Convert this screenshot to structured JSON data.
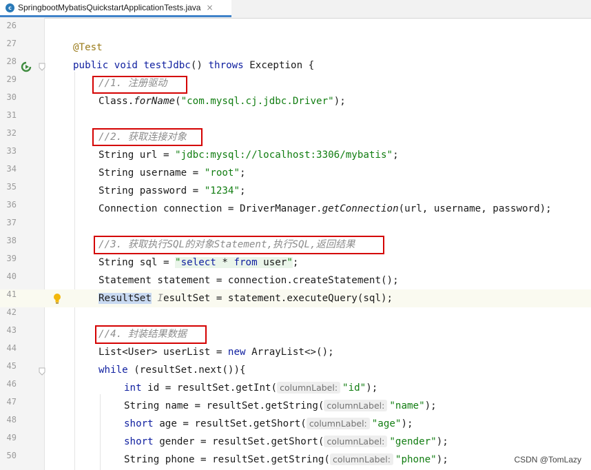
{
  "tab": {
    "title": "SpringbootMybatisQuickstartApplicationTests.java",
    "close": "×",
    "icon": "c"
  },
  "lines": [
    {
      "n": "26",
      "tokens": []
    },
    {
      "n": "27",
      "tokens": [
        {
          "t": "@Test",
          "c": "ann"
        }
      ]
    },
    {
      "n": "28",
      "tokens": [
        {
          "t": "public void ",
          "c": "kw"
        },
        {
          "t": "testJdbc",
          "c": "kw"
        },
        {
          "t": "() "
        },
        {
          "t": "throws",
          "c": "kw"
        },
        {
          "t": " Exception {"
        }
      ]
    },
    {
      "n": "29",
      "tokens": [
        {
          "t": "//1. 注册驱动",
          "c": "cmt"
        }
      ]
    },
    {
      "n": "30",
      "tokens": [
        {
          "t": "Class."
        },
        {
          "t": "forName",
          "c": "it"
        },
        {
          "t": "("
        },
        {
          "t": "\"com.mysql.cj.jdbc.Driver\"",
          "c": "str"
        },
        {
          "t": ");"
        }
      ]
    },
    {
      "n": "31",
      "tokens": []
    },
    {
      "n": "32",
      "tokens": [
        {
          "t": "//2. 获取连接对象",
          "c": "cmt"
        }
      ]
    },
    {
      "n": "33",
      "tokens": [
        {
          "t": "String url = "
        },
        {
          "t": "\"jdbc:mysql://localhost:3306/mybatis\"",
          "c": "str"
        },
        {
          "t": ";"
        }
      ]
    },
    {
      "n": "34",
      "tokens": [
        {
          "t": "String username = "
        },
        {
          "t": "\"root\"",
          "c": "str"
        },
        {
          "t": ";"
        }
      ]
    },
    {
      "n": "35",
      "tokens": [
        {
          "t": "String password = "
        },
        {
          "t": "\"1234\"",
          "c": "str"
        },
        {
          "t": ";"
        }
      ]
    },
    {
      "n": "36",
      "tokens": [
        {
          "t": "Connection connection = DriverManager."
        },
        {
          "t": "getConnection",
          "c": "it"
        },
        {
          "t": "(url, username, password);"
        }
      ]
    },
    {
      "n": "37",
      "tokens": []
    },
    {
      "n": "38",
      "tokens": [
        {
          "t": "//3. 获取执行SQL的对象Statement,执行SQL,返回结果",
          "c": "cmt"
        }
      ]
    },
    {
      "n": "39",
      "tokens": [
        {
          "t": "String sql = "
        },
        {
          "t": "\"",
          "c": "str sqlbg"
        },
        {
          "t": "select",
          "c": "kw sqlbg"
        },
        {
          "t": " * ",
          "c": "sqlbg"
        },
        {
          "t": "from",
          "c": "kw sqlbg"
        },
        {
          "t": " user",
          "c": "sqlbg"
        },
        {
          "t": "\"",
          "c": "str sqlbg"
        },
        {
          "t": ";"
        }
      ]
    },
    {
      "n": "40",
      "tokens": [
        {
          "t": "Statement statement = connection.createStatement();"
        }
      ]
    },
    {
      "n": "41",
      "tokens": [
        {
          "t": "ResultSet",
          "c": "selword"
        },
        {
          "t": " "
        },
        {
          "t": "I",
          "c": "cmt"
        },
        {
          "t": "esultSet = statement.executeQuery(sql);"
        }
      ]
    },
    {
      "n": "42",
      "tokens": []
    },
    {
      "n": "43",
      "tokens": [
        {
          "t": "//4. 封装结果数据",
          "c": "cmt"
        }
      ]
    },
    {
      "n": "44",
      "tokens": [
        {
          "t": "List<User> userList = "
        },
        {
          "t": "new",
          "c": "kw"
        },
        {
          "t": " ArrayList<>();"
        }
      ]
    },
    {
      "n": "45",
      "tokens": [
        {
          "t": "while",
          "c": "kw"
        },
        {
          "t": " (resultSet.next()){"
        }
      ]
    },
    {
      "n": "46",
      "tokens": [
        {
          "t": "int",
          "c": "kw"
        },
        {
          "t": " id = resultSet.getInt("
        },
        {
          "t": "columnLabel:",
          "c": "hint"
        },
        {
          "t": "\"id\"",
          "c": "str"
        },
        {
          "t": ");"
        }
      ]
    },
    {
      "n": "47",
      "tokens": [
        {
          "t": "String name = resultSet.getString("
        },
        {
          "t": "columnLabel:",
          "c": "hint"
        },
        {
          "t": "\"name\"",
          "c": "str"
        },
        {
          "t": ");"
        }
      ]
    },
    {
      "n": "48",
      "tokens": [
        {
          "t": "short",
          "c": "kw"
        },
        {
          "t": " age = resultSet.getShort("
        },
        {
          "t": "columnLabel:",
          "c": "hint"
        },
        {
          "t": "\"age\"",
          "c": "str"
        },
        {
          "t": ");"
        }
      ]
    },
    {
      "n": "49",
      "tokens": [
        {
          "t": "short",
          "c": "kw"
        },
        {
          "t": " gender = resultSet.getShort("
        },
        {
          "t": "columnLabel:",
          "c": "hint"
        },
        {
          "t": "\"gender\"",
          "c": "str"
        },
        {
          "t": ");"
        }
      ]
    },
    {
      "n": "50",
      "tokens": [
        {
          "t": "String phone = resultSet.getString("
        },
        {
          "t": "columnLabel:",
          "c": "hint"
        },
        {
          "t": "\"phone\"",
          "c": "str"
        },
        {
          "t": ");"
        }
      ]
    }
  ],
  "gutter_icons": {
    "run": "run-test-icon",
    "fold": "fold-marker-icon",
    "bulb": "intention-bulb-icon"
  },
  "watermark": "CSDN @TomLazy",
  "colors": {
    "keyword": "#1020a0",
    "string": "#117d11",
    "comment": "#8c8c8c",
    "annotation": "#9a7b1a",
    "highlight_box": "#d40000"
  }
}
